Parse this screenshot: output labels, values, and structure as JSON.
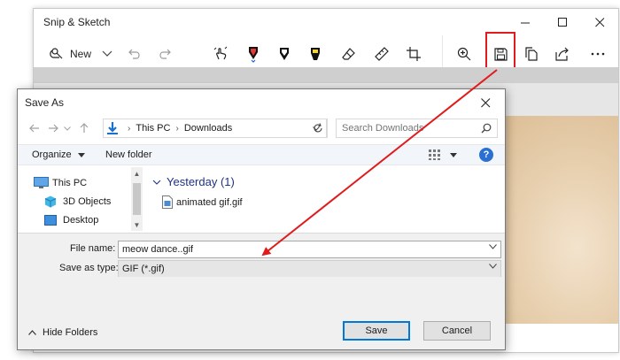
{
  "colors": {
    "accent": "#0078d7",
    "annotation_red": "#e01b1b",
    "help_blue": "#2a6fd2",
    "folder_yellow": "#e9b94a"
  },
  "snip": {
    "title": "Snip & Sketch",
    "new_label": "New",
    "icons": [
      "new-snip-icon",
      "chevron-down-icon",
      "undo-icon",
      "redo-icon",
      "touch-writing-icon",
      "ballpoint-pen-icon",
      "pencil-icon",
      "highlighter-icon",
      "eraser-icon",
      "ruler-icon",
      "crop-icon",
      "zoom-icon",
      "save-icon",
      "copy-icon",
      "share-icon",
      "more-icon"
    ]
  },
  "dialog": {
    "title": "Save As",
    "breadcrumb": [
      "This PC",
      "Downloads"
    ],
    "search_placeholder": "Search Downloads",
    "organize_label": "Organize",
    "new_folder_label": "New folder",
    "help_label": "?",
    "nav_tree": [
      {
        "label": "This PC",
        "icon": "computer-icon"
      },
      {
        "label": "3D Objects",
        "icon": "cube-icon"
      },
      {
        "label": "Desktop",
        "icon": "desktop-icon"
      }
    ],
    "group_header": "Yesterday (1)",
    "files": [
      {
        "name": "animated gif.gif",
        "icon": "gif-file-icon"
      }
    ],
    "file_name_label": "File name:",
    "file_name_value": "meow dance..gif",
    "save_type_label": "Save as type:",
    "save_type_value": "GIF (*.gif)",
    "hide_folders_label": "Hide Folders",
    "save_label": "Save",
    "cancel_label": "Cancel"
  }
}
